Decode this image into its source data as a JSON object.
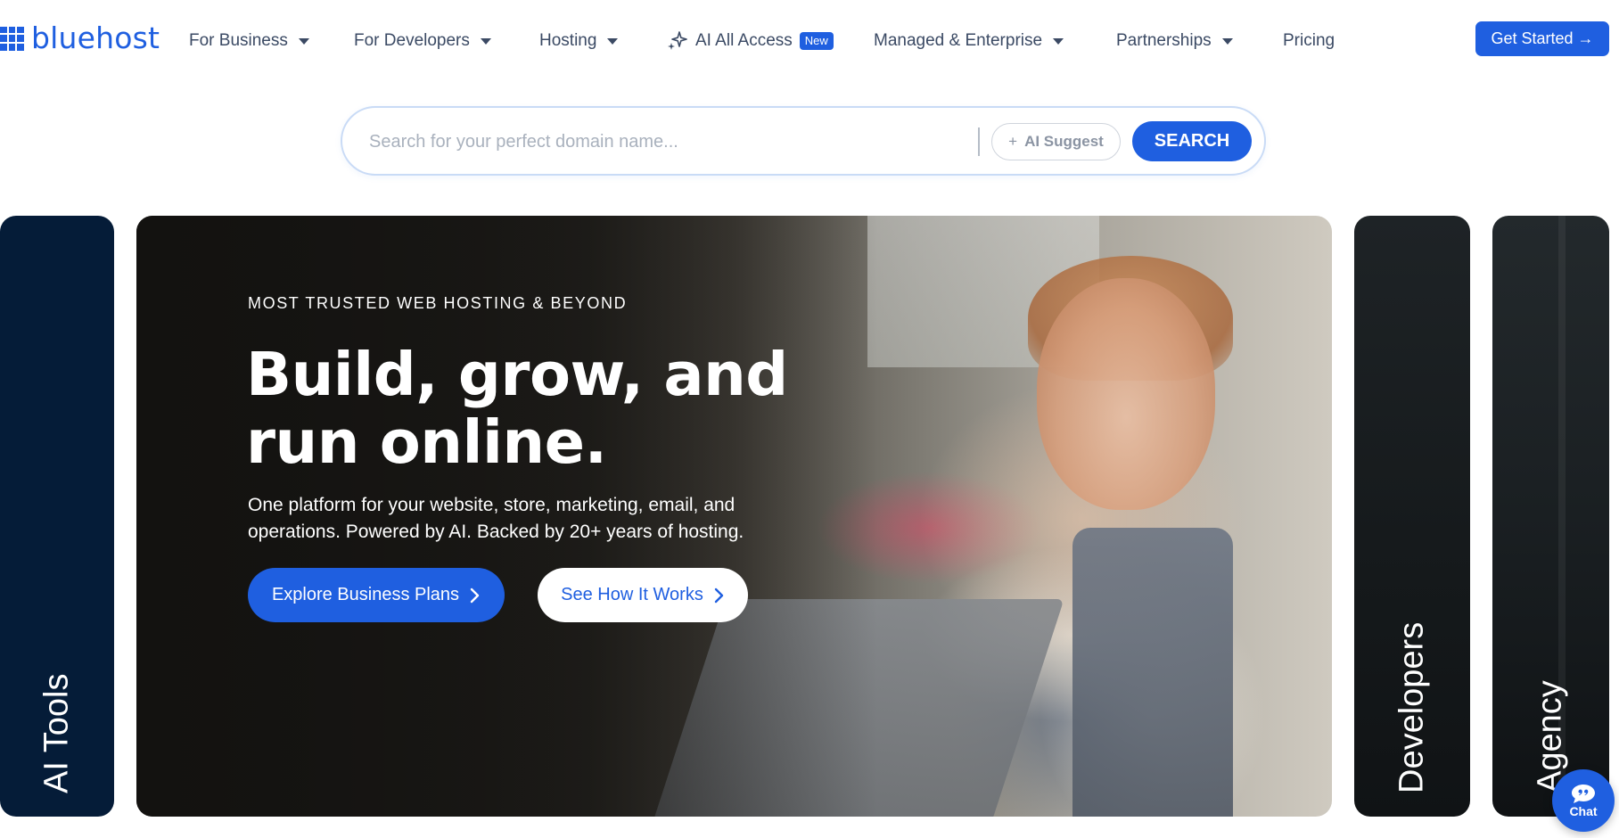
{
  "brand": {
    "name": "bluehost",
    "color": "#1f5fe0"
  },
  "nav": {
    "items": [
      {
        "label": "For Business",
        "has_dropdown": true
      },
      {
        "label": "For Developers",
        "has_dropdown": true
      },
      {
        "label": "Hosting",
        "has_dropdown": true
      },
      {
        "label": "AI All Access",
        "badge": "New",
        "icon": "sparkle-icon"
      },
      {
        "label": "Managed & Enterprise",
        "has_dropdown": true
      },
      {
        "label": "Partnerships",
        "has_dropdown": true
      },
      {
        "label": "Pricing"
      }
    ],
    "cta": "Get Started →"
  },
  "search": {
    "placeholder": "Search for your perfect domain name...",
    "value": "",
    "ai_suggest_label": "AI Suggest",
    "button_label": "SEARCH"
  },
  "carousel": {
    "side_cards": [
      {
        "label": "AI Tools",
        "bg": "#051c38"
      },
      {
        "label": "Developers",
        "bg": "#1a1f22"
      },
      {
        "label": "Agency",
        "bg": "#1c2124"
      }
    ],
    "hero": {
      "eyebrow": "MOST TRUSTED WEB HOSTING & BEYOND",
      "title": "Build, grow, and run online.",
      "subtitle": "One platform for your website, store, marketing, email, and operations. Powered by AI. Backed by 20+ years of hosting.",
      "primary_button": "Explore Business Plans",
      "secondary_button": "See How It Works"
    }
  },
  "chat": {
    "label": "Chat",
    "icon": "chat-bubble-icon"
  }
}
